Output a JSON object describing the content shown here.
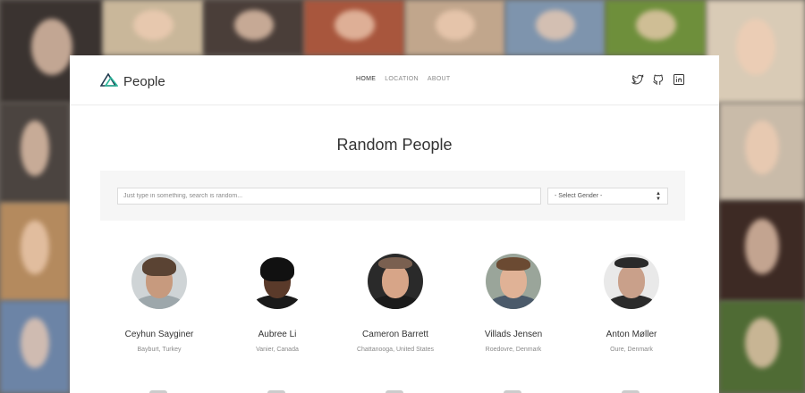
{
  "brand": {
    "name": "People",
    "accent": "#2bb59a"
  },
  "nav": {
    "items": [
      {
        "label": "HOME",
        "active": true
      },
      {
        "label": "LOCATION",
        "active": false
      },
      {
        "label": "ABOUT",
        "active": false
      }
    ]
  },
  "social": [
    "twitter-icon",
    "github-icon",
    "linkedin-icon"
  ],
  "page": {
    "title": "Random People"
  },
  "search": {
    "value": "",
    "placeholder": "Just type in something, search is random...",
    "gender_selected": "- Select Gender -"
  },
  "people": [
    {
      "name": "Ceyhun Sayginer",
      "location": "Bayburt, Turkey"
    },
    {
      "name": "Aubree Li",
      "location": "Vanier, Canada"
    },
    {
      "name": "Cameron Barrett",
      "location": "Chattanooga, United States"
    },
    {
      "name": "Villads Jensen",
      "location": "Roedovre, Denmark"
    },
    {
      "name": "Anton Møller",
      "location": "Oure, Denmark"
    }
  ]
}
